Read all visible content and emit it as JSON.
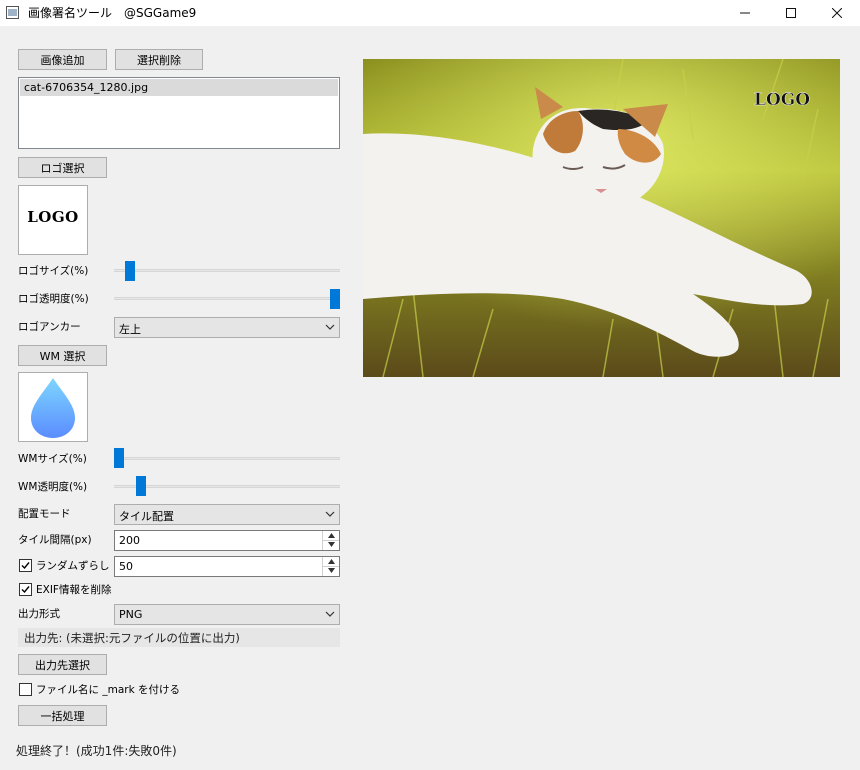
{
  "window": {
    "title": "画像署名ツール　@SGGame9"
  },
  "buttons": {
    "add_image": "画像追加",
    "remove_selected": "選択削除",
    "select_logo": "ロゴ選択",
    "select_wm": "WM 選択",
    "select_output": "出力先選択",
    "batch_process": "一括処理"
  },
  "files": [
    "cat-6706354_1280.jpg"
  ],
  "logo": {
    "preview_text": "LOGO",
    "size_label": "ロゴサイズ(%)",
    "size_level": 0.05,
    "opacity_label": "ロゴ透明度(%)",
    "opacity_level": 1.0,
    "anchor_label": "ロゴアンカー",
    "anchor_value": "左上"
  },
  "wm": {
    "size_label": "WMサイズ(%)",
    "size_level": 0.0,
    "opacity_label": "WM透明度(%)",
    "opacity_level": 0.1,
    "mode_label": "配置モード",
    "mode_value": "タイル配置",
    "gap_label": "タイル間隔(px)",
    "gap_value": "200",
    "random_label": "ランダムずらし",
    "random_checked": true,
    "random_value": "50"
  },
  "exif": {
    "label": "EXIF情報を削除",
    "checked": true
  },
  "output": {
    "format_label": "出力形式",
    "format_value": "PNG",
    "path_text": "出力先: (未選択:元ファイルの位置に出力)",
    "suffix_label": "ファイル名に _mark を付ける",
    "suffix_checked": false
  },
  "preview": {
    "logo_text": "LOGO"
  },
  "status": {
    "text": "処理終了！(成功1件:失敗0件)"
  },
  "colors": {
    "accent": "#0078d7",
    "wm_top": "#7ed6ff",
    "wm_bottom": "#5a8cff"
  }
}
